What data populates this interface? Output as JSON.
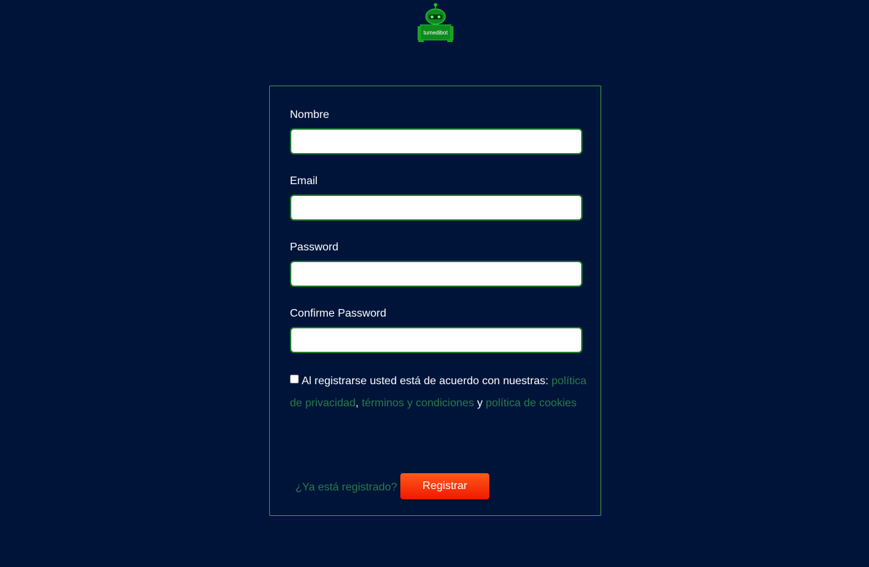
{
  "brand": {
    "logo_text": "tumedibot",
    "logo_icon": "robot-icon",
    "accent_color": "#1a9a2a"
  },
  "form": {
    "fields": [
      {
        "label": "Nombre",
        "value": "",
        "placeholder": ""
      },
      {
        "label": "Email",
        "value": "",
        "placeholder": ""
      },
      {
        "label": "Password",
        "value": "",
        "placeholder": ""
      },
      {
        "label": "Confirme Password",
        "value": "",
        "placeholder": ""
      }
    ],
    "terms": {
      "checked": false,
      "prefix": "Al registrarse usted está de acuerdo con nuestras: ",
      "privacy_link": "política de privacidad",
      "separator": ", ",
      "terms_link": "términos y condiciones",
      "conjunction": " y ",
      "cookies_link": "política de cookies"
    },
    "login_link": "¿Ya está registrado?",
    "submit_label": "Registrar"
  },
  "colors": {
    "background": "#00143a",
    "link": "#2a7a4a",
    "button": "#ff3a0a",
    "input_border": "#1a7a2a"
  }
}
